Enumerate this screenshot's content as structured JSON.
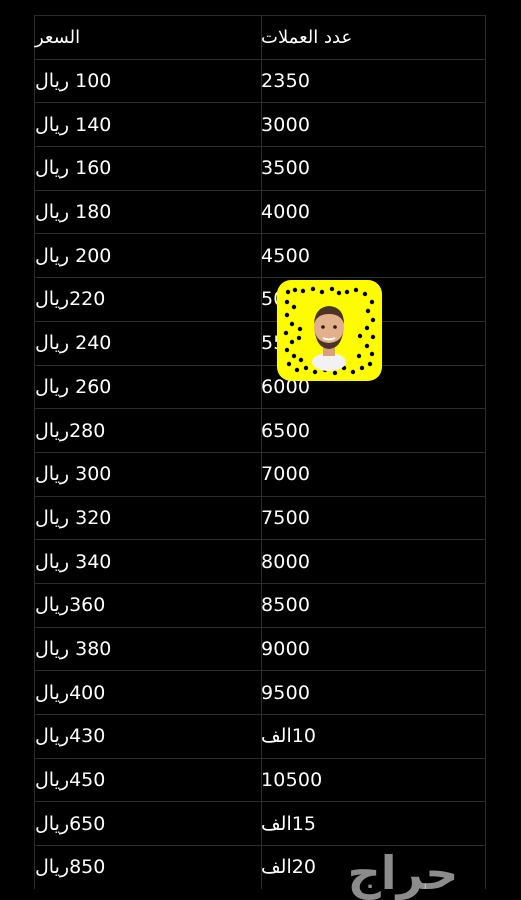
{
  "table": {
    "header": {
      "coins": "عدد العملات",
      "price": "السعر"
    },
    "rows": [
      {
        "coins": "2350",
        "price": "100 ريال"
      },
      {
        "coins": "3000",
        "price": "140 ريال"
      },
      {
        "coins": "3500",
        "price": "160 ريال"
      },
      {
        "coins": "4000",
        "price": "180 ريال"
      },
      {
        "coins": "4500",
        "price": "200 ريال"
      },
      {
        "coins": "5000",
        "price": "220ريال"
      },
      {
        "coins": "5500",
        "price": "240 ريال"
      },
      {
        "coins": "6000",
        "price": "260 ريال"
      },
      {
        "coins": "6500",
        "price": "280ريال"
      },
      {
        "coins": "7000",
        "price": "300 ريال"
      },
      {
        "coins": "7500",
        "price": "320 ريال"
      },
      {
        "coins": "8000",
        "price": "340 ريال"
      },
      {
        "coins": "8500",
        "price": "360ريال"
      },
      {
        "coins": "9000",
        "price": "380 ريال"
      },
      {
        "coins": "9500",
        "price": "400ريال"
      },
      {
        "coins": "10الف",
        "price": "430ريال"
      },
      {
        "coins": "10500",
        "price": "450ريال"
      },
      {
        "coins": "15الف",
        "price": "650ريال"
      },
      {
        "coins": "20الف",
        "price": "850ريال"
      }
    ]
  },
  "snapcode": {
    "icon": "snapcode-icon",
    "color": "#fffc00"
  },
  "watermark": {
    "text": "حراج"
  }
}
